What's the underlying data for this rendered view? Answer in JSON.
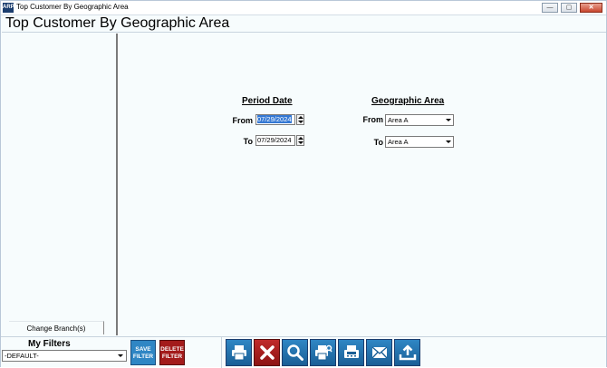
{
  "window": {
    "title": "Top Customer By Geographic Area",
    "icon_label": "ARP"
  },
  "header": {
    "title": "Top Customer By Geographic Area"
  },
  "sidebar": {
    "change_branch_label": "Change Branch(s)"
  },
  "period_date": {
    "title": "Period Date",
    "from_label": "From",
    "from_value": "07/29/2024",
    "to_label": "To",
    "to_value": "07/29/2024"
  },
  "geographic_area": {
    "title": "Geographic Area",
    "from_label": "From",
    "from_value": "Area A",
    "to_label": "To",
    "to_value": "Area A"
  },
  "filters": {
    "title": "My Filters",
    "selected": "-DEFAULT-",
    "save_label_1": "SAVE",
    "save_label_2": "FILTER",
    "delete_label_1": "DELETE",
    "delete_label_2": "FILTER"
  },
  "toolbar": {
    "icons": [
      "print-icon",
      "cancel-icon",
      "search-icon",
      "print-preview-icon",
      "fax-icon",
      "email-icon",
      "export-icon"
    ]
  },
  "colors": {
    "save_button": "#2f86c4",
    "delete_button": "#a31b1b",
    "toolbar_blue": "#2172ad",
    "background": "#f7fcfd"
  }
}
